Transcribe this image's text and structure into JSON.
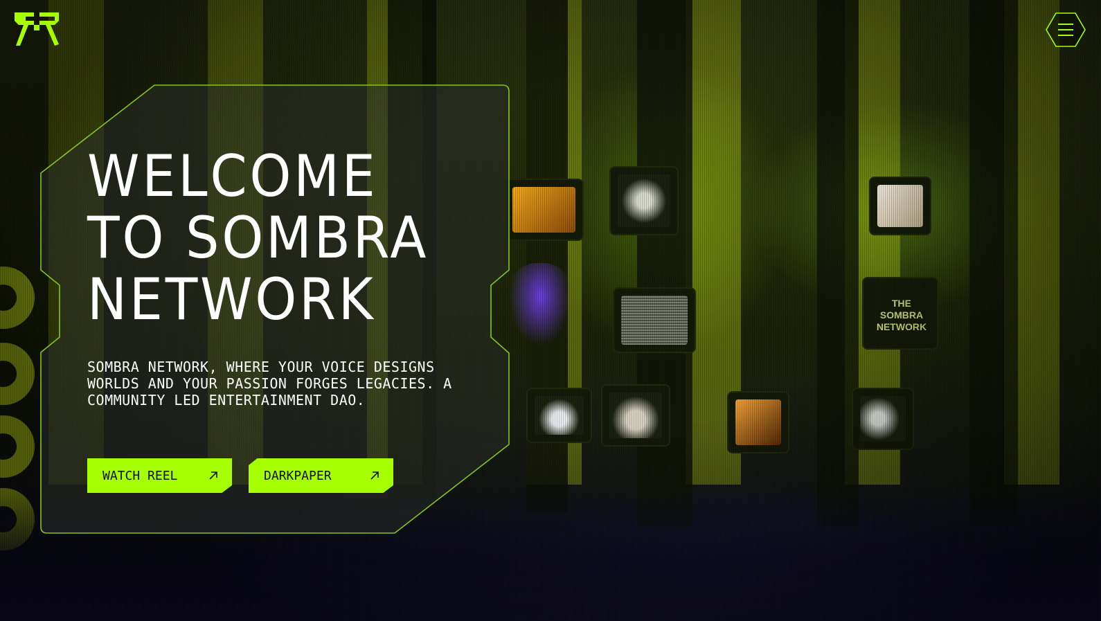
{
  "brand": {
    "logo": "sombra-logo-icon",
    "accent_color": "#a6ff00"
  },
  "header": {
    "menu_icon": "hamburger-menu-icon"
  },
  "hero": {
    "title_lines": [
      "WELCOME",
      "TO SOMBRA",
      "NETWORK"
    ],
    "description": "SOMBRA NETWORK, WHERE YOUR VOICE DESIGNS WORLDS AND YOUR PASSION FORGES LEGACIES. A COMMUNITY LED ENTERTAINMENT DAO.",
    "buttons": [
      {
        "label": "WATCH REEL",
        "icon": "arrow-up-right-icon"
      },
      {
        "label": "DARKPAPER",
        "icon": "arrow-up-right-icon"
      }
    ]
  },
  "background": {
    "screen_sign_lines": [
      "THE",
      "SOMBRA",
      "NETWORK"
    ]
  }
}
